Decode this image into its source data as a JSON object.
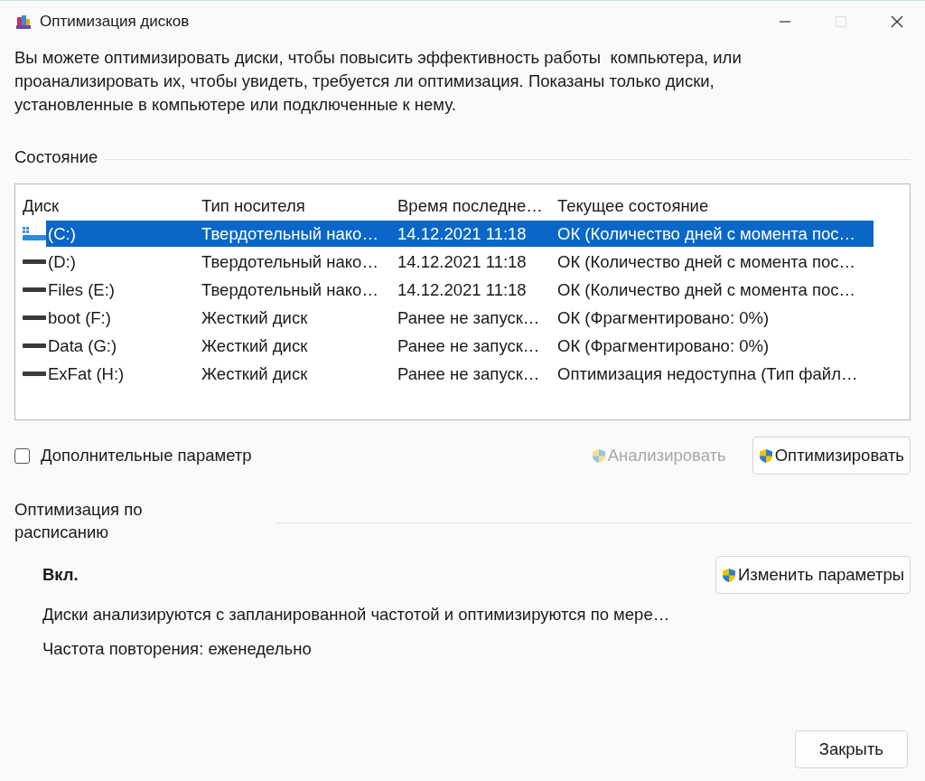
{
  "window": {
    "title": "Оптимизация дисков",
    "maximize_disabled": true
  },
  "description": "Вы можете оптимизировать диски, чтобы повысить эффективность работы  компьютера, или проанализировать их, чтобы увидеть, требуется ли оптимизация. Показаны только диски, установленные в компьютере или подключенные к нему.",
  "status_label": "Состояние",
  "table": {
    "columns": [
      "Диск",
      "Тип носителя",
      "Время последне…",
      "Текущее состояние"
    ],
    "rows": [
      {
        "kind": "system",
        "disk": "(C:)",
        "media_type": "Твердотельный нако…",
        "last_run": "14.12.2021 11:18",
        "status": "ОК (Количество дней с момента пос…",
        "selected": true
      },
      {
        "kind": "drive",
        "disk": "(D:)",
        "media_type": "Твердотельный нако…",
        "last_run": "14.12.2021 11:18",
        "status": "ОК (Количество дней с момента пос…",
        "selected": false
      },
      {
        "kind": "drive",
        "disk": "Files (E:)",
        "media_type": "Твердотельный нако…",
        "last_run": "14.12.2021 11:18",
        "status": "ОК (Количество дней с момента пос…",
        "selected": false
      },
      {
        "kind": "drive",
        "disk": "boot (F:)",
        "media_type": "Жесткий диск",
        "last_run": "Ранее не запуск…",
        "status": "ОК (Фрагментировано: 0%)",
        "selected": false
      },
      {
        "kind": "drive",
        "disk": "Data (G:)",
        "media_type": "Жесткий диск",
        "last_run": "Ранее не запуск…",
        "status": "ОК (Фрагментировано: 0%)",
        "selected": false
      },
      {
        "kind": "drive",
        "disk": "ExFat (H:)",
        "media_type": "Жесткий диск",
        "last_run": "Ранее не запуск…",
        "status": "Оптимизация недоступна (Тип файл…",
        "selected": false
      }
    ]
  },
  "advanced": {
    "label": "Дополнительные параметр",
    "checked": false
  },
  "actions": [
    {
      "label": "Анализировать",
      "disabled": true
    },
    {
      "label": "Оптимизировать",
      "disabled": false
    }
  ],
  "schedule": {
    "heading": "Оптимизация по расписанию",
    "state": "Вкл.",
    "change_button": "Изменить параметры",
    "description": "Диски анализируются с запланированной частотой и оптимизируются по мере…",
    "frequency": "Частота повторения: еженедельно"
  },
  "close_button": "Закрыть"
}
